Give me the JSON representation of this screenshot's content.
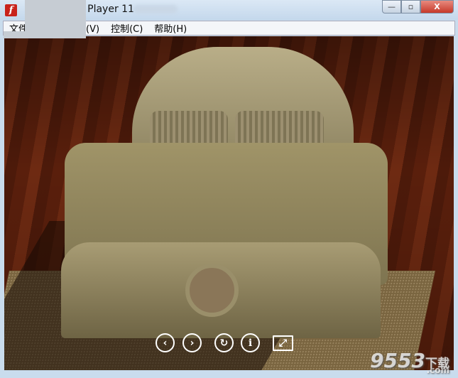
{
  "window": {
    "title": "Flash Player 11",
    "app_icon": "flash-icon",
    "minimize": "—",
    "maximize": "▫",
    "close": "X"
  },
  "menu": {
    "items": [
      {
        "label": "文件"
      },
      {
        "label": "查看(V)"
      },
      {
        "label": "控制(C)"
      },
      {
        "label": "帮助(H)"
      }
    ]
  },
  "controls": [
    {
      "icon": "previous-icon",
      "glyph": "‹"
    },
    {
      "icon": "next-icon",
      "glyph": "›"
    },
    {
      "icon": "rotate-icon",
      "glyph": "↻"
    },
    {
      "icon": "info-icon",
      "glyph": "i"
    },
    {
      "icon": "fullscreen-icon",
      "glyph": "⤢"
    }
  ],
  "watermark": {
    "number": "9553",
    "cn": "下载",
    "suffix": ".com"
  }
}
